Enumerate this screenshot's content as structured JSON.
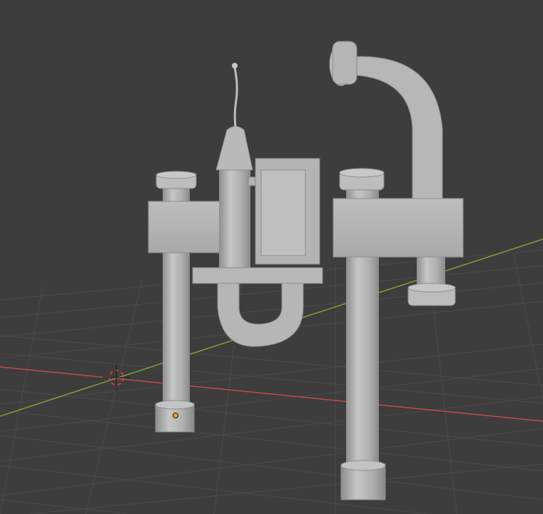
{
  "viewport": {
    "view_mode": "solid",
    "background_color": "#3d3d3d",
    "grid_color": "#4a4a4a",
    "x_axis_color": "#c04a4a",
    "y_axis_color": "#7ea03a",
    "mesh_color": "#b9b9b9"
  },
  "scene": {
    "objects": [
      "pipe-assembly-mesh",
      "overhead-spout-mesh",
      "u-trap-pipe",
      "valve-box",
      "antenna-probe"
    ],
    "icons": [
      "3d-cursor-icon",
      "object-origin-icon"
    ]
  }
}
